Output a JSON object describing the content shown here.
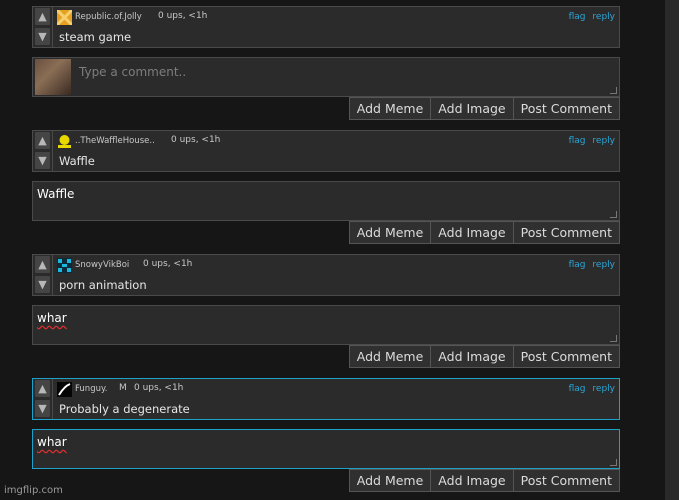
{
  "threads": [
    {
      "username": "Republic.of.Jolly",
      "meta": "0 ups, <1h",
      "flag": "flag",
      "reply": "reply",
      "text": "steam game",
      "reply_value": "",
      "reply_placeholder": "Type a comment..",
      "avatar_color": "#e8a020"
    },
    {
      "username": "..TheWaffleHouse..",
      "meta": "0 ups, <1h",
      "flag": "flag",
      "reply": "reply",
      "text": "Waffle",
      "reply_value": "Waffle",
      "avatar_color": "#e6d800"
    },
    {
      "username": "SnowyVikBoi",
      "meta": "0 ups, <1h",
      "flag": "flag",
      "reply": "reply",
      "text": "porn animation",
      "reply_value": "whar",
      "avatar_color": "#1ab8e0"
    },
    {
      "username": "Funguy.",
      "badge": "M",
      "meta": "0 ups, <1h",
      "flag": "flag",
      "reply": "reply",
      "text": "Probably a degenerate",
      "reply_value": "whar",
      "avatar_color": "#ffffff"
    }
  ],
  "buttons": {
    "add_meme": "Add Meme",
    "add_image": "Add Image",
    "post_comment": "Post Comment"
  },
  "vote_icons": {
    "up": "arrow-up-icon",
    "down": "arrow-down-icon"
  },
  "watermark": "imgflip.com"
}
